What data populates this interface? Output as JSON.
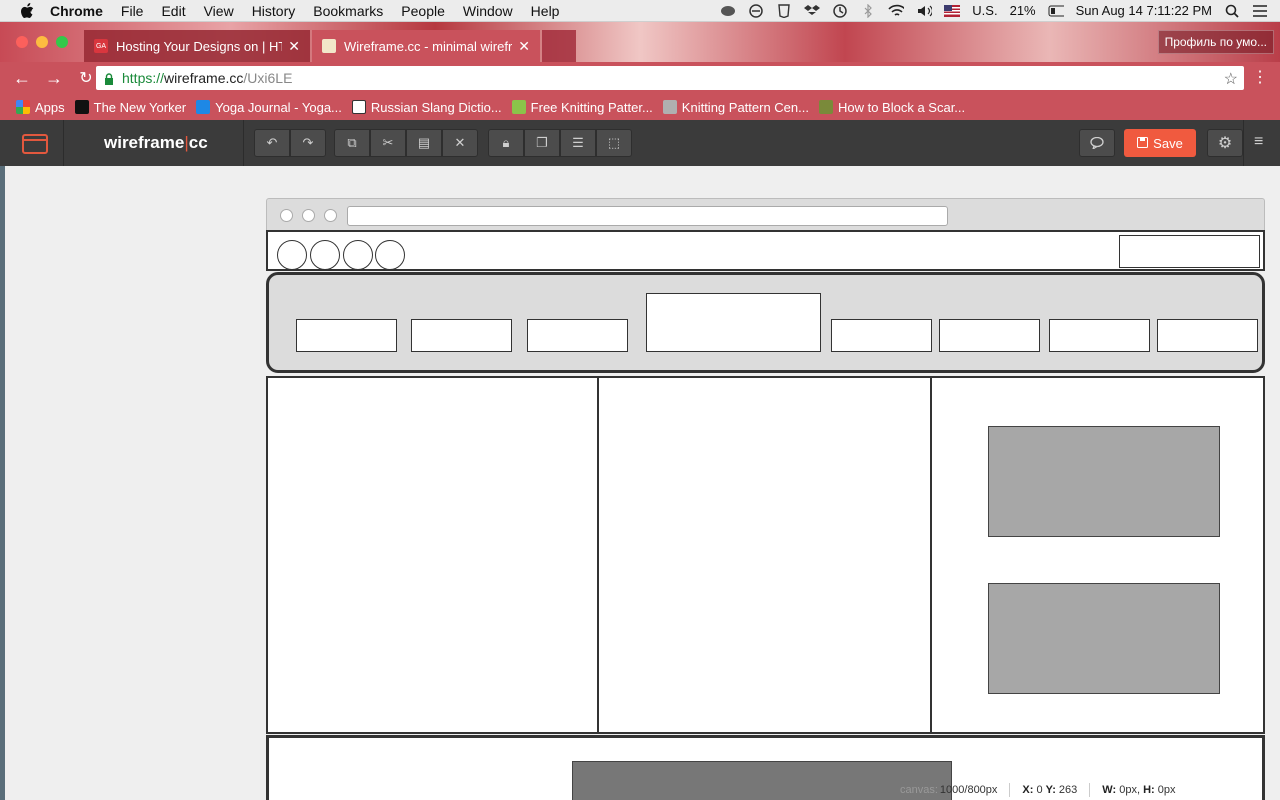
{
  "menubar": {
    "app_name": "Chrome",
    "items": [
      "File",
      "Edit",
      "View",
      "History",
      "Bookmarks",
      "People",
      "Window",
      "Help"
    ],
    "input_source": "U.S.",
    "battery": "21%",
    "clock": "Sun Aug 14  7:11:22 PM"
  },
  "tabs": [
    {
      "title": "Hosting Your Designs on | HTM",
      "favicon_color": "#d9363e",
      "favicon_text": "GA"
    },
    {
      "title": "Wireframe.cc - minimal wirefra",
      "favicon_color": "#f2e7c9"
    }
  ],
  "profile_label": "Профиль по умо...",
  "omnibox": {
    "protocol": "https://",
    "host": "wireframe.cc",
    "path": "/Uxi6LE"
  },
  "bookmarks": [
    {
      "label": "Apps",
      "icon": "apps-grid-icon"
    },
    {
      "label": "The New Yorker",
      "icon": "new-yorker-icon"
    },
    {
      "label": "Yoga Journal - Yoga...",
      "icon": "yoga-icon"
    },
    {
      "label": "Russian Slang Dictio...",
      "icon": "russian-slang-icon"
    },
    {
      "label": "Free Knitting Patter...",
      "icon": "knitting-icon"
    },
    {
      "label": "Knitting Pattern Cen...",
      "icon": "knitting-center-icon"
    },
    {
      "label": "How to Block a Scar...",
      "icon": "scarf-icon"
    }
  ],
  "app": {
    "brand_left": "wireframe",
    "brand_pipe": "|",
    "brand_right": "cc",
    "save_label": "Save",
    "colors": {
      "accent": "#f05a3f",
      "header_bg": "#3b3b3b",
      "canvas_bg": "#efefef"
    }
  },
  "statusbar": {
    "canvas_label": "canvas:",
    "canvas_value": "1000/800px",
    "xy_x_label": "X:",
    "xy_x_value": "0",
    "xy_y_label": "Y:",
    "xy_y_value": "263",
    "w_label": "W:",
    "w_value": "0px,",
    "h_label": "H:",
    "h_value": "0px"
  }
}
